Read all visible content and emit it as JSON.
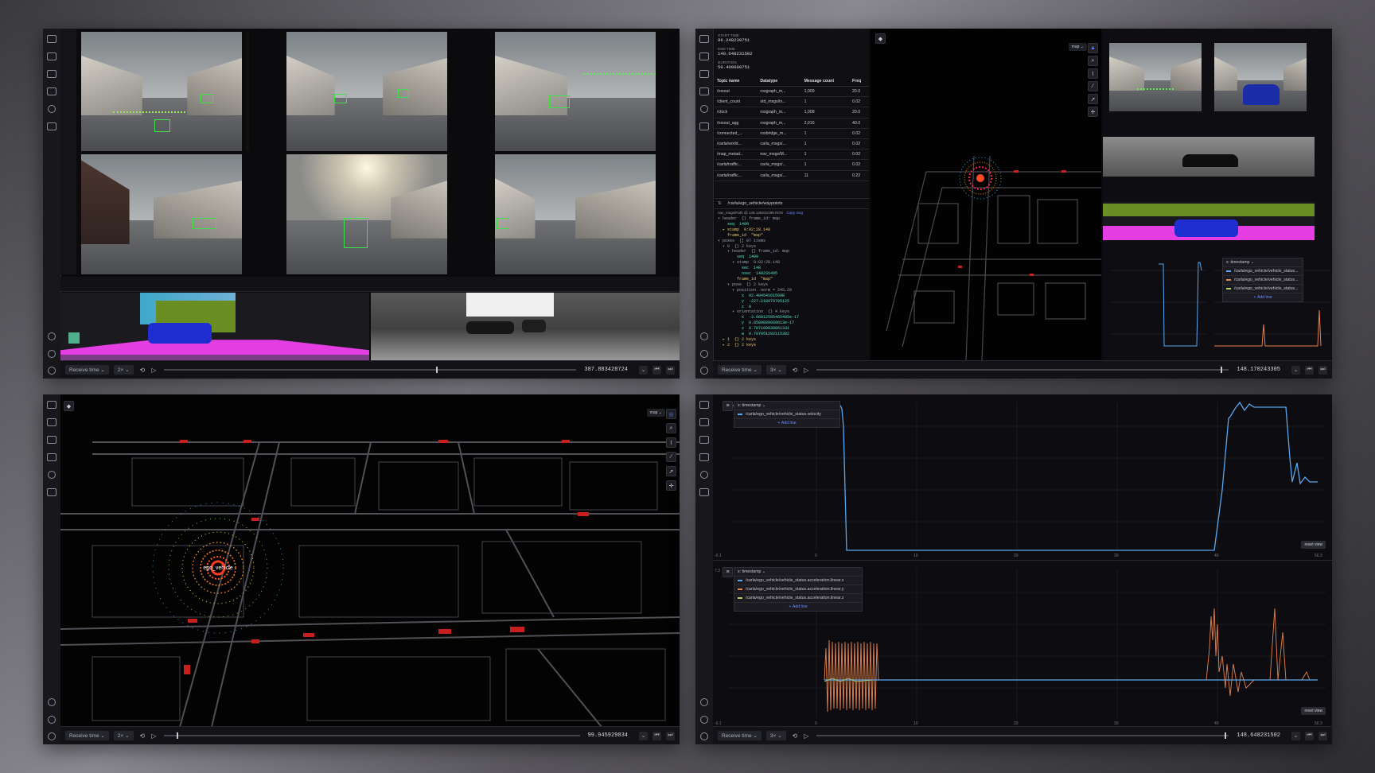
{
  "playback": {
    "p1": {
      "source": "Receive time",
      "speed": "2×",
      "time": "387.883428724"
    },
    "p2": {
      "source": "Receive time",
      "speed": "3×",
      "time": "148.170243305"
    },
    "p3": {
      "source": "Receive time",
      "speed": "2×",
      "time": "99.945929834"
    },
    "p4": {
      "source": "Receive time",
      "speed": "3×",
      "time": "148.648231502"
    }
  },
  "topics_panel": {
    "start_label": "START TIME",
    "start_value": "96.248230751",
    "end_label": "END TIME",
    "end_value": "148.648231502",
    "duration_label": "DURATION",
    "duration_value": "50.400000751",
    "headers": [
      "Topic name",
      "Datatype",
      "Message count",
      "Freq"
    ],
    "rows": [
      [
        "/rosout",
        "rosgraph_m...",
        "1,009",
        "20.0"
      ],
      [
        "/client_count",
        "std_msgs/In...",
        "1",
        "0.02"
      ],
      [
        "/clock",
        "rosgraph_m...",
        "1,008",
        "20.0"
      ],
      [
        "/rosout_agg",
        "rosgraph_m...",
        "2,016",
        "40.0"
      ],
      [
        "/connected_...",
        "rosbridge_m...",
        "1",
        "0.02"
      ],
      [
        "/carla/world...",
        "carla_msgs/...",
        "1",
        "0.02"
      ],
      [
        "/map_metad...",
        "nav_msgs/M...",
        "1",
        "0.02"
      ],
      [
        "/carla/traffic...",
        "carla_msgs/...",
        "1",
        "0.02"
      ],
      [
        "/carla/traffic...",
        "carla_msgs/...",
        "11",
        "0.22"
      ]
    ]
  },
  "raw_message": {
    "topic": "/carla/ego_vehicle/waypoints",
    "type_line": "nav_msgs/Path @ 148.148231495 ROS",
    "copy": "Copy msg",
    "lines": [
      {
        "t": "▾ header  {} frame_id: map",
        "c": "g"
      },
      {
        "t": "    seq  1400",
        "c": "n"
      },
      {
        "t": "  ▸ stamp  0:02:28.148",
        "c": "v"
      },
      {
        "t": "    frame_id  \"map\"",
        "c": "v"
      },
      {
        "t": "▾ poses  [] 87 items",
        "c": "g"
      },
      {
        "t": "  ▾ 0  {} 2 keys",
        "c": "g"
      },
      {
        "t": "    ▾ header  {} frame_id: map",
        "c": "g"
      },
      {
        "t": "        seq  1400",
        "c": "n"
      },
      {
        "t": "      ▾ stamp  0:02:28.148",
        "c": "g"
      },
      {
        "t": "          sec  148",
        "c": "n"
      },
      {
        "t": "          nsec  148231495",
        "c": "n"
      },
      {
        "t": "        frame_id  \"map\"",
        "c": "v"
      },
      {
        "t": "    ▾ pose  {} 2 keys",
        "c": "g"
      },
      {
        "t": "      ▾ position  norm = 245.29",
        "c": "g"
      },
      {
        "t": "          x  92.40454161560B",
        "c": "n"
      },
      {
        "t": "          y  -227.218979795125",
        "c": "n"
      },
      {
        "t": "          z  0",
        "c": "n"
      },
      {
        "t": "      ▾ orientation  {} 4 keys",
        "c": "g"
      },
      {
        "t": "          x  -3.66812595465485e-17",
        "c": "n"
      },
      {
        "t": "          y  8.8589889669613e-17",
        "c": "n"
      },
      {
        "t": "          z  0.707109030861331",
        "c": "n"
      },
      {
        "t": "          w  0.707051292115392",
        "c": "n"
      },
      {
        "t": "  ▸ 1  {} 2 keys",
        "c": "v"
      },
      {
        "t": "  ▸ 2  {} 2 keys",
        "c": "v"
      }
    ]
  },
  "three_d": {
    "frame": "map",
    "ego_label": "ego_vehicle"
  },
  "plot_small": {
    "x_label": "x: timestamp",
    "series": [
      "/carla/ego_vehicle/vehicle_status...",
      "/carla/ego_vehicle/vehicle_status...",
      "/carla/ego_vehicle/vehicle_status..."
    ],
    "add": "Add line"
  },
  "plot_velocity": {
    "x_label": "x: timestamp",
    "series": [
      "/carla/ego_vehicle/vehicle_status.velocity"
    ],
    "add": "Add line",
    "reset": "reset view",
    "xticks": [
      "0",
      "10",
      "20",
      "30",
      "40",
      "50.3"
    ],
    "xmin": "-0.1"
  },
  "plot_accel": {
    "x_label": "x: timestamp",
    "series": [
      "/carla/ego_vehicle/vehicle_status.acceleration.linear.x",
      "/carla/ego_vehicle/vehicle_status.acceleration.linear.y",
      "/carla/ego_vehicle/vehicle_status.acceleration.linear.z"
    ],
    "add": "Add line",
    "reset": "reset view",
    "xticks": [
      "0",
      "10",
      "20",
      "30",
      "40",
      "50.3"
    ],
    "xmin": "-0.1",
    "ytop": "7.3"
  },
  "colors": {
    "series_blue": "#5aa7ef",
    "series_orange": "#e8824a",
    "series_green": "#a9d46b",
    "accent": "#5c7cfa"
  }
}
